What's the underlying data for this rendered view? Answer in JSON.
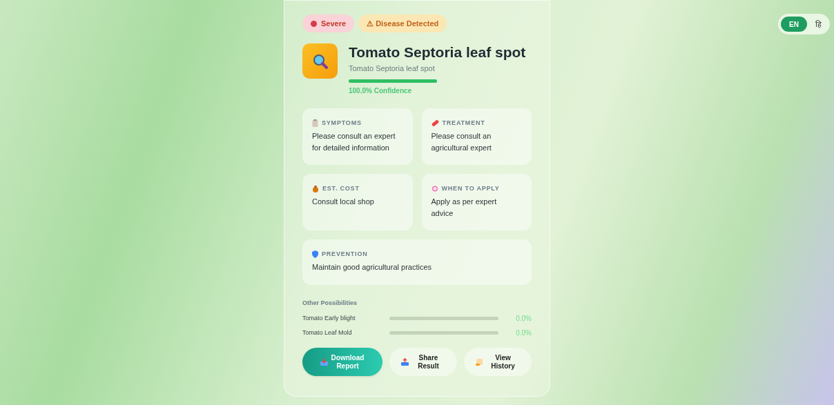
{
  "language_toggle": [
    {
      "label": "EN",
      "selected": true
    },
    {
      "label": "हि",
      "selected": false
    }
  ],
  "badges": [
    {
      "kind": "severity",
      "label": "Severe"
    },
    {
      "kind": "status",
      "label": "⚠ Disease Detected"
    }
  ],
  "diagnosis": {
    "title": "Tomato Septoria leaf spot",
    "subtitle": "Tomato Septoria leaf spot",
    "level": 1,
    "confidence": "100.0% Confidence"
  },
  "info_cards": [
    {
      "kind": "symptoms",
      "label": "SYMPTOMS",
      "text": "Please consult an expert for detailed information"
    },
    {
      "kind": "treatment",
      "label": "TREATMENT",
      "text": "Please consult an agricultural expert"
    },
    {
      "kind": "cost",
      "label": "EST. COST",
      "text": "Consult local shop"
    },
    {
      "kind": "timing",
      "label": "WHEN TO APPLY",
      "text": "Apply as per expert advice"
    },
    {
      "kind": "prevention",
      "label": "PREVENTION",
      "text": "Maintain good agricultural practices"
    }
  ],
  "other_possibilities": {
    "title": "Other Possibilities",
    "items": [
      {
        "name": "Tomato Early blight",
        "level": 0,
        "reading": "0.0%"
      },
      {
        "name": "Tomato Leaf Mold",
        "level": 0,
        "reading": "0.0%"
      }
    ]
  },
  "actions": [
    {
      "kind": "download",
      "label": "Download Report"
    },
    {
      "kind": "share",
      "label": "Share Result"
    },
    {
      "kind": "history",
      "label": "View History"
    }
  ]
}
